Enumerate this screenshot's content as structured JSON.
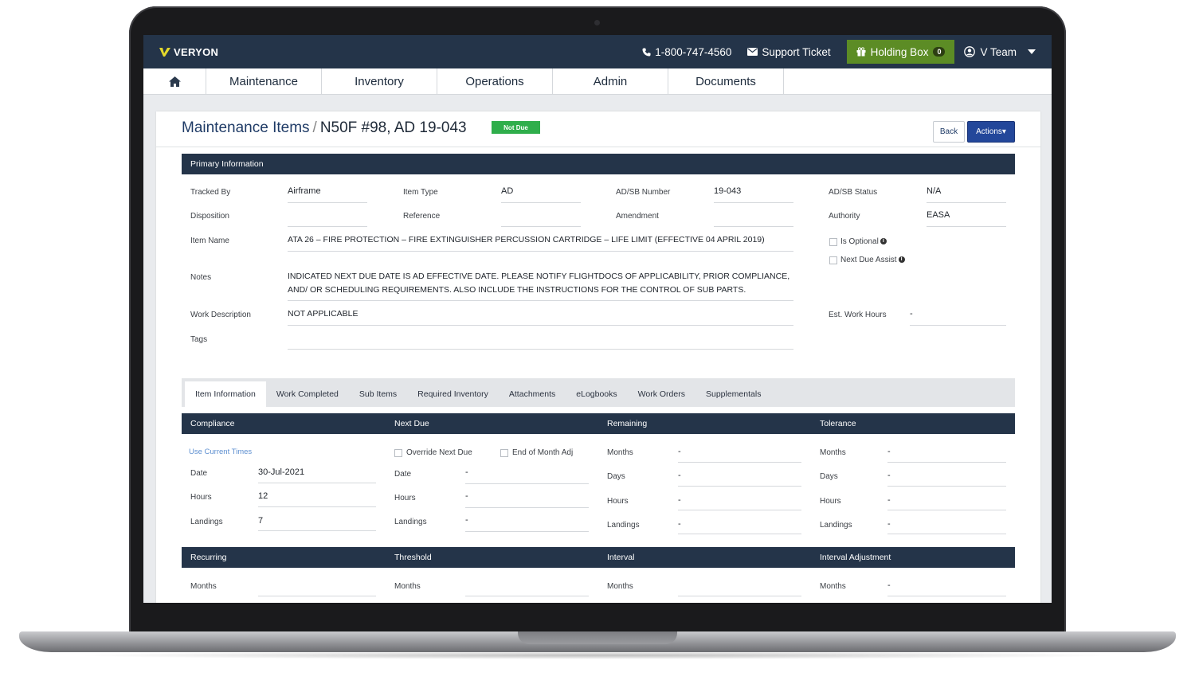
{
  "header": {
    "logo_text": "VERYON",
    "phone": "1-800-747-4560",
    "support": "Support Ticket",
    "holding_box": "Holding Box",
    "holding_count": "0",
    "user": "V Team"
  },
  "nav": [
    "Maintenance",
    "Inventory",
    "Operations",
    "Admin",
    "Documents"
  ],
  "page": {
    "crumb_root": "Maintenance Items",
    "crumb_sep": "/",
    "crumb_current": "N50F #98, AD 19-043",
    "status": "Not Due",
    "back": "Back",
    "actions": "Actions▾"
  },
  "primary": {
    "title": "Primary Information",
    "tracked_by_label": "Tracked By",
    "tracked_by": "Airframe",
    "item_type_label": "Item Type",
    "item_type": "AD",
    "adsb_number_label": "AD/SB Number",
    "adsb_number": "19-043",
    "adsb_status_label": "AD/SB Status",
    "adsb_status": "N/A",
    "disposition_label": "Disposition",
    "reference_label": "Reference",
    "amendment_label": "Amendment",
    "authority_label": "Authority",
    "authority": "EASA",
    "item_name_label": "Item Name",
    "item_name": "ATA 26 – FIRE PROTECTION – FIRE EXTINGUISHER PERCUSSION CARTRIDGE – LIFE LIMIT (EFFECTIVE 04 APRIL 2019)",
    "is_optional": "Is Optional",
    "next_due_assist": "Next Due Assist",
    "notes_label": "Notes",
    "notes_line1": "INDICATED NEXT DUE DATE IS AD EFFECTIVE DATE. PLEASE NOTIFY FLIGHTDOCS OF APPLICABILITY, PRIOR COMPLIANCE,",
    "notes_line2": "AND/ OR SCHEDULING REQUIREMENTS. ALSO INCLUDE THE INSTRUCTIONS FOR THE CONTROL OF SUB PARTS.",
    "work_desc_label": "Work Description",
    "work_desc": "NOT APPLICABLE",
    "est_hours_label": "Est. Work Hours",
    "est_hours": "-",
    "tags_label": "Tags"
  },
  "tabs": [
    "Item Information",
    "Work Completed",
    "Sub Items",
    "Required Inventory",
    "Attachments",
    "eLogbooks",
    "Work Orders",
    "Supplementals"
  ],
  "compliance": {
    "title": "Compliance",
    "use_current": "Use Current Times",
    "date_label": "Date",
    "date": "30-Jul-2021",
    "hours_label": "Hours",
    "hours": "12",
    "landings_label": "Landings",
    "landings": "7"
  },
  "next_due": {
    "title": "Next Due",
    "override": "Override Next Due",
    "end_month": "End of Month Adj",
    "date_label": "Date",
    "date": "-",
    "hours_label": "Hours",
    "hours": "-",
    "landings_label": "Landings",
    "landings": "-"
  },
  "remaining": {
    "title": "Remaining",
    "months_label": "Months",
    "months": "-",
    "days_label": "Days",
    "days": "-",
    "hours_label": "Hours",
    "hours": "-",
    "landings_label": "Landings",
    "landings": "-"
  },
  "tolerance": {
    "title": "Tolerance",
    "months_label": "Months",
    "months": "-",
    "days_label": "Days",
    "days": "-",
    "hours_label": "Hours",
    "hours": "-",
    "landings_label": "Landings",
    "landings": "-"
  },
  "bottom": {
    "recurring": "Recurring",
    "threshold": "Threshold",
    "interval": "Interval",
    "interval_adj": "Interval Adjustment",
    "months_label": "Months",
    "interval_adj_months": "-"
  }
}
